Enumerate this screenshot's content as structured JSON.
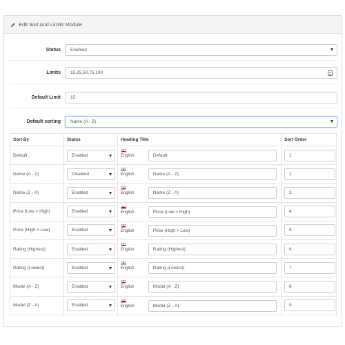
{
  "panel": {
    "title": "Edit Sort And Limits Module"
  },
  "form": {
    "status": {
      "label": "Status",
      "value": "Enabled"
    },
    "limits": {
      "label": "Limits",
      "value": "15,25,50,75,100"
    },
    "default_limit": {
      "label": "Default Limit",
      "value": "15"
    },
    "default_sorting": {
      "label": "Default sorting",
      "value": "Name (A - Z)"
    }
  },
  "table": {
    "headers": [
      "Sort By",
      "Status",
      "Heading Title",
      "Sort Order"
    ],
    "language": "English",
    "rows": [
      {
        "sort_by": "Default",
        "status": "Enabled",
        "heading": "Default",
        "order": "1"
      },
      {
        "sort_by": "Name (A - Z)",
        "status": "Disabled",
        "heading": "Name (A - Z)",
        "order": "2"
      },
      {
        "sort_by": "Name (Z - A)",
        "status": "Enabled",
        "heading": "Name (Z - A)",
        "order": "3"
      },
      {
        "sort_by": "Price (Low > High)",
        "status": "Enabled",
        "heading": "Price (Low > High)",
        "order": "4"
      },
      {
        "sort_by": "Price (High > Low)",
        "status": "Enabled",
        "heading": "Price (High > Low)",
        "order": "5"
      },
      {
        "sort_by": "Rating (Highest)",
        "status": "Enabled",
        "heading": "Rating (Highest)",
        "order": "6"
      },
      {
        "sort_by": "Rating (Lowest)",
        "status": "Enabled",
        "heading": "Rating (Lowest)",
        "order": "7"
      },
      {
        "sort_by": "Model (A - Z)",
        "status": "Enabled",
        "heading": "Model (A - Z)",
        "order": "8"
      },
      {
        "sort_by": "Model (Z - A)",
        "status": "Enabled",
        "heading": "Model (Z - A)",
        "order": "9"
      }
    ]
  },
  "icons": {
    "heading": "pencil-icon",
    "select": "caret-down-icon",
    "limits": "list-icon",
    "language": "uk-flag-icon"
  }
}
